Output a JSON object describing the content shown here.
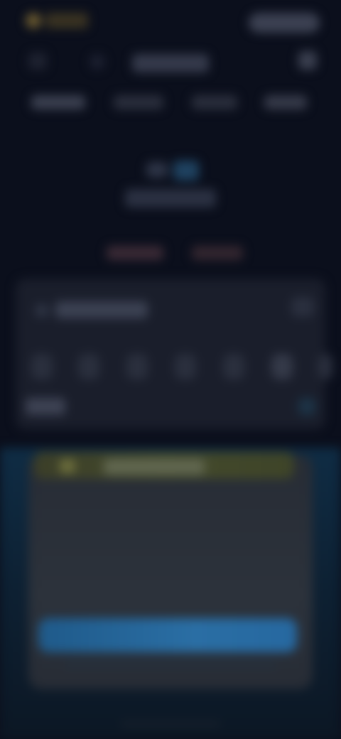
{
  "app": {
    "title": "",
    "accent_color": "#2a6ea4",
    "banner_color": "#444a2c",
    "background": "#0b0f1c"
  },
  "header": {
    "title": "",
    "tabs": [
      "",
      "",
      "",
      ""
    ]
  },
  "hero": {
    "label": "",
    "meta": [
      "",
      ""
    ]
  },
  "card": {
    "title": "",
    "days": [
      "",
      "",
      "",
      "",
      "",
      "",
      ""
    ],
    "footer_label": ""
  },
  "sheet": {
    "banner_text": "",
    "cta_label": "",
    "cta_subtext": ""
  },
  "icons": {
    "logo": "logo-icon",
    "back": "back-icon",
    "menu": "menu-icon",
    "settings": "settings-icon",
    "banner": "sun-icon"
  }
}
